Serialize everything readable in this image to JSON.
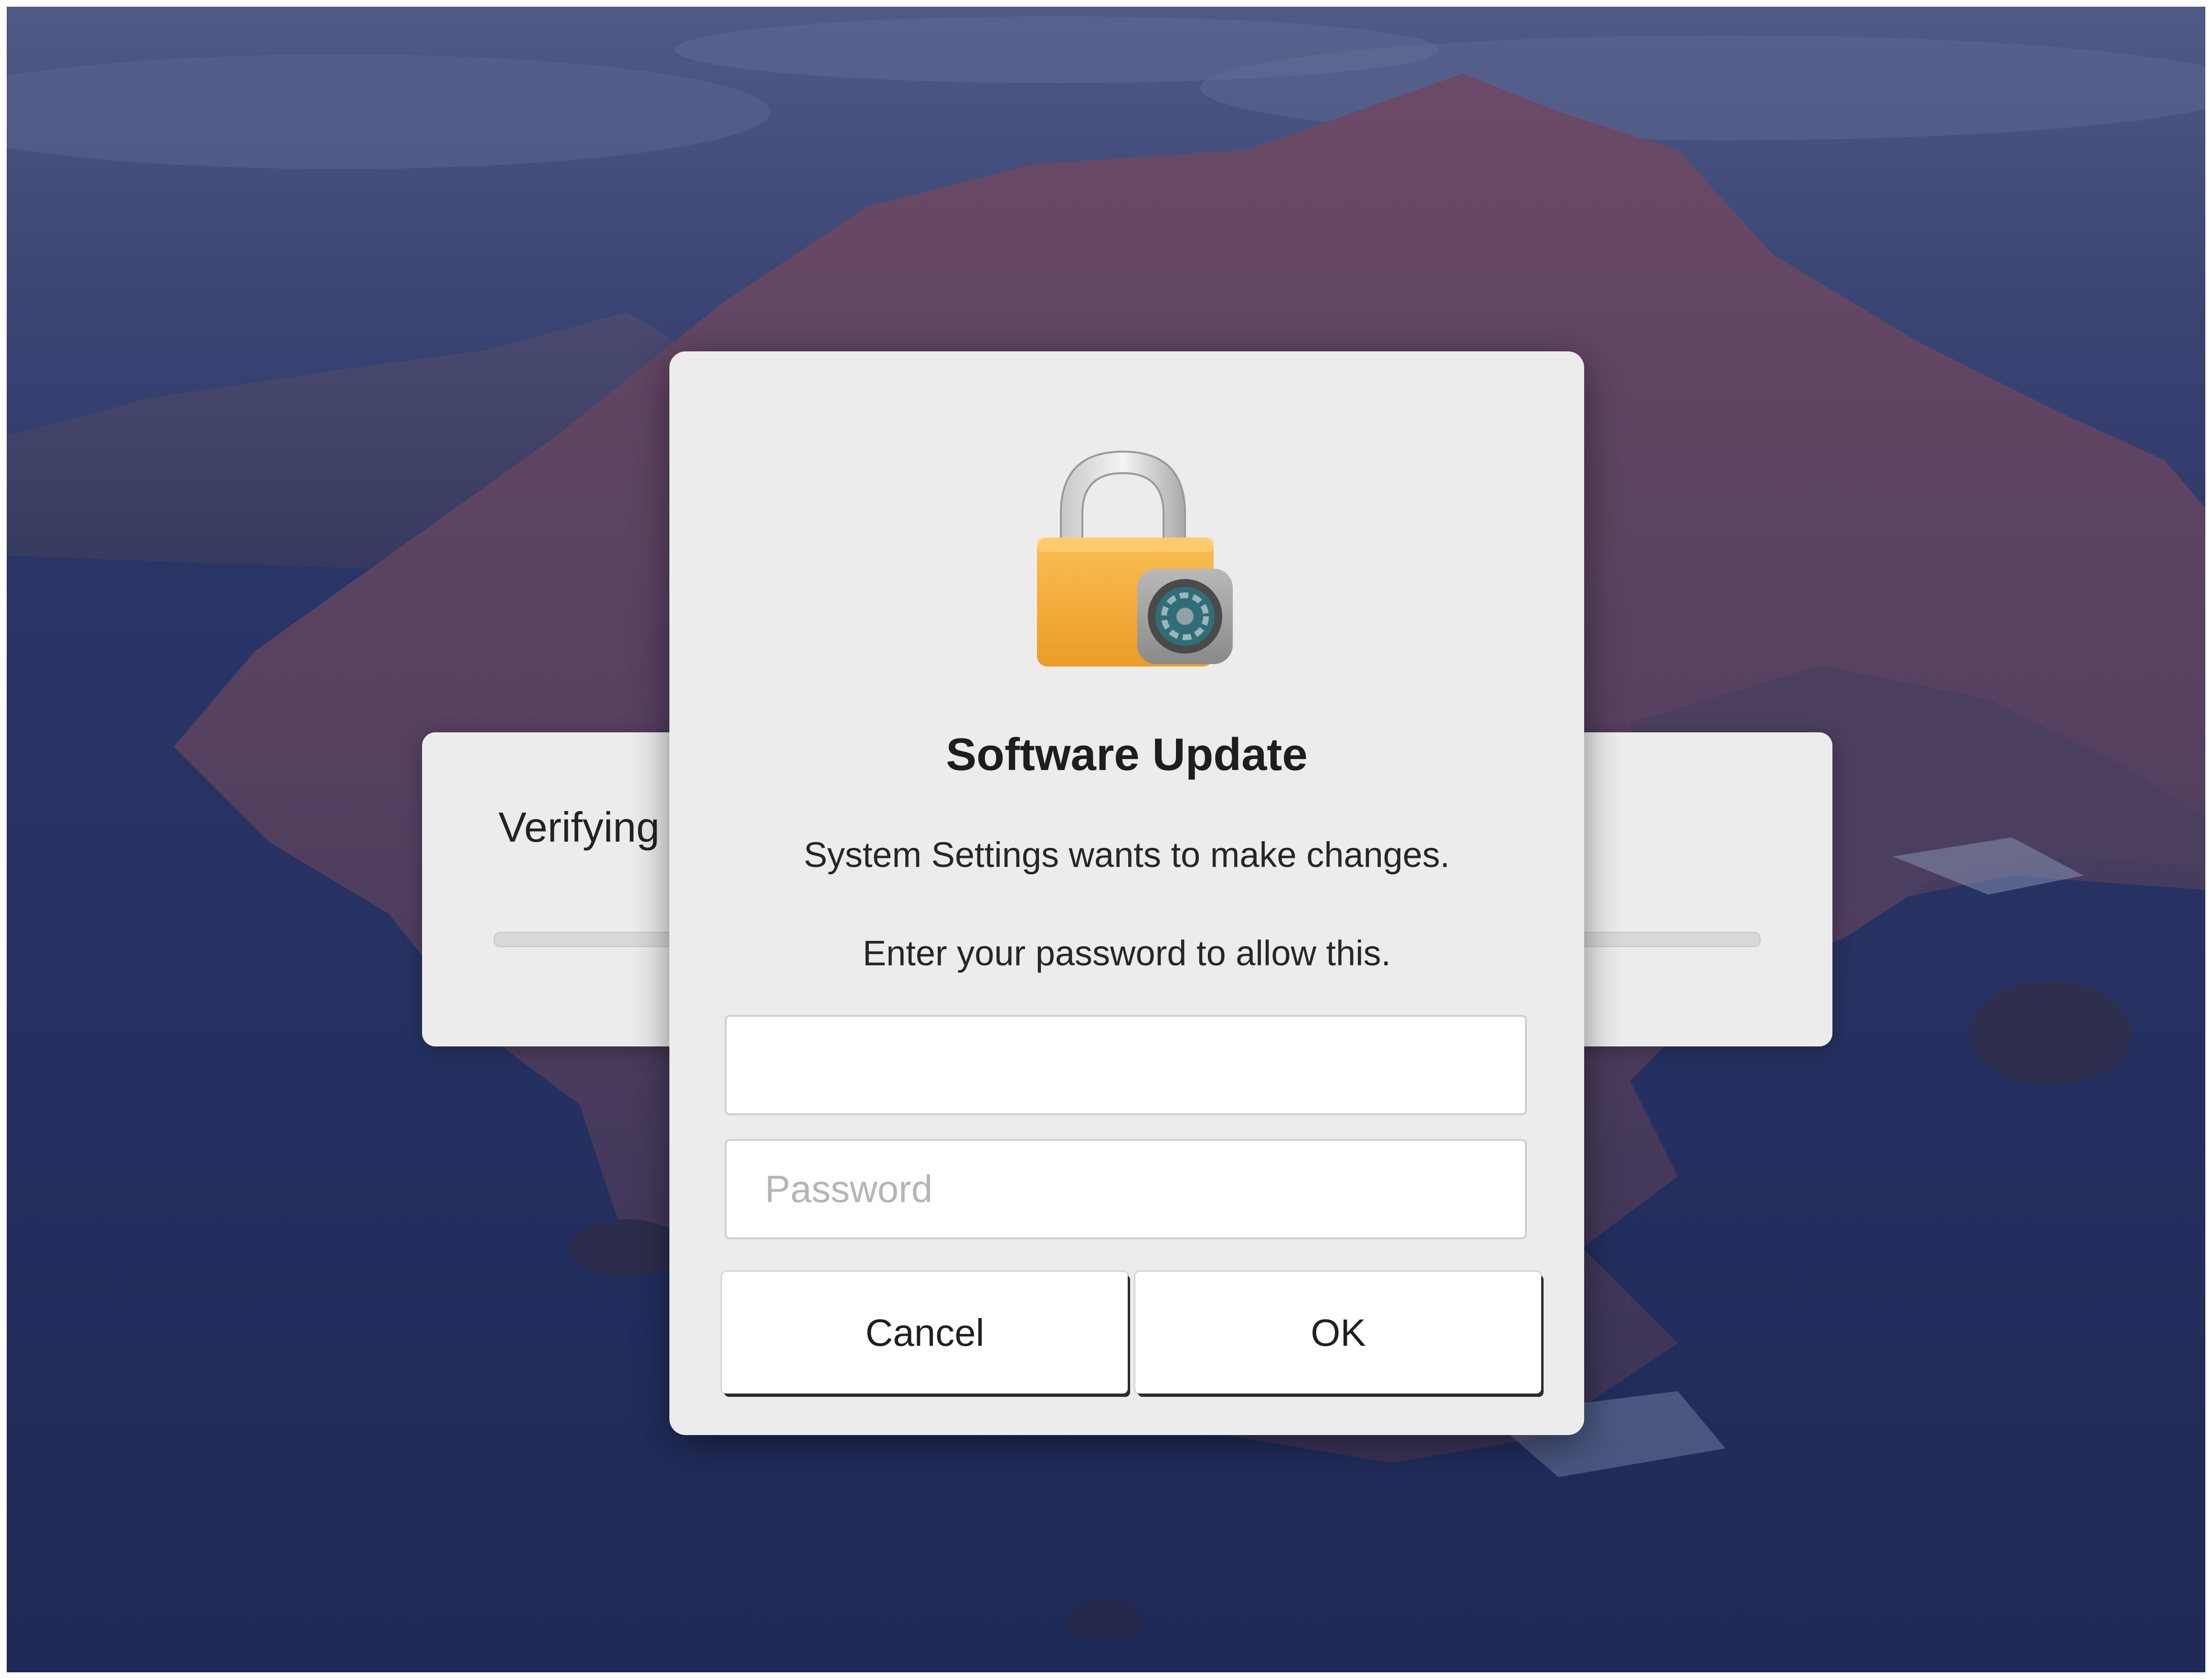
{
  "background_window": {
    "status_text": "Verifying"
  },
  "dialog": {
    "icon": "lock-gear-icon",
    "title": "Software Update",
    "message_line1": "System Settings wants to make changes.",
    "message_line2": "Enter your password to allow this.",
    "username_value": "",
    "password_placeholder": "Password",
    "cancel_label": "Cancel",
    "ok_label": "OK"
  },
  "colors": {
    "lock_body": "#f4a93a",
    "dialog_background": "#ececec",
    "wallpaper_sky": "#3a4576",
    "wallpaper_sea": "#283463"
  }
}
